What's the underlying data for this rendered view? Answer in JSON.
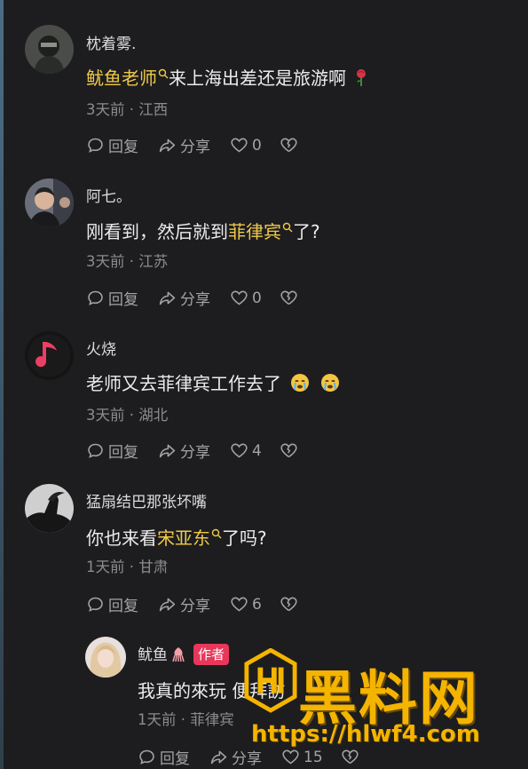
{
  "comments": [
    {
      "user": "枕着雾.",
      "link_text": "鱿鱼老师",
      "text_after": "来上海出差还是旅游啊",
      "trail_emoji": "rose",
      "meta": "3天前 · 江西",
      "reply_label": "回复",
      "share_label": "分享",
      "likes": "0"
    },
    {
      "user": "阿七。",
      "text_before": "刚看到，然后就到",
      "link_text": "菲律宾",
      "text_after": "了?",
      "meta": "3天前 · 江苏",
      "reply_label": "回复",
      "share_label": "分享",
      "likes": "0"
    },
    {
      "user": "火烧",
      "text": "老师又去菲律宾工作去了",
      "trail_emoji": "crying-face x2",
      "meta": "3天前 · 湖北",
      "reply_label": "回复",
      "share_label": "分享",
      "likes": "4"
    },
    {
      "user": "猛扇结巴那张坏嘴",
      "text_before": "你也来看",
      "link_text": "宋亚东",
      "text_after": "了吗?",
      "meta": "1天前 · 甘肃",
      "reply_label": "回复",
      "share_label": "分享",
      "likes": "6"
    }
  ],
  "reply": {
    "user": "鱿鱼",
    "badge": "作者",
    "text": "我真的來玩 便拜訪",
    "meta": "1天前 · 菲律宾",
    "reply_label": "回复",
    "share_label": "分享",
    "likes": "15"
  },
  "watermark": {
    "text": "黑料网",
    "url": "https://hlwf4.com"
  },
  "colors": {
    "background": "#1d1d1f",
    "link": "#f0c94a",
    "author_badge": "#e8375a",
    "watermark": "#f4b400"
  }
}
